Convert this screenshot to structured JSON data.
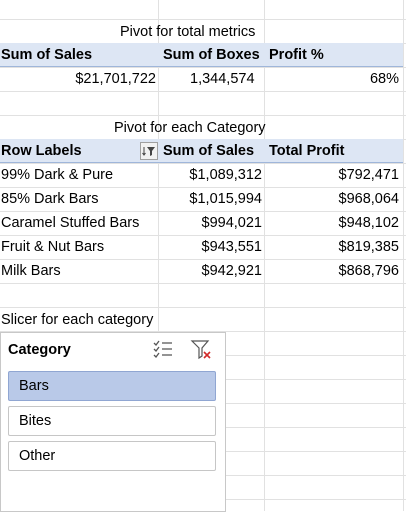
{
  "total_pivot": {
    "title": "Pivot for total metrics",
    "headers": [
      "Sum of Sales",
      "Sum of Boxes",
      "Profit %"
    ],
    "values": [
      "$21,701,722",
      "1,344,574",
      "68%"
    ]
  },
  "category_pivot": {
    "title": "Pivot for each Category",
    "headers": [
      "Row Labels",
      "Sum of Sales",
      "Total Profit"
    ],
    "rows": [
      {
        "label": "99% Dark & Pure",
        "sales": "$1,089,312",
        "profit": "$792,471"
      },
      {
        "label": "85% Dark Bars",
        "sales": "$1,015,994",
        "profit": "$968,064"
      },
      {
        "label": "Caramel Stuffed Bars",
        "sales": "$994,021",
        "profit": "$948,102"
      },
      {
        "label": "Fruit & Nut Bars",
        "sales": "$943,551",
        "profit": "$819,385"
      },
      {
        "label": "Milk Bars",
        "sales": "$942,921",
        "profit": "$868,796"
      }
    ]
  },
  "slicer": {
    "caption": "Slicer for each category",
    "header": "Category",
    "items": [
      {
        "label": "Bars",
        "selected": true
      },
      {
        "label": "Bites",
        "selected": false
      },
      {
        "label": "Other",
        "selected": false
      }
    ]
  },
  "colors": {
    "header_band": "#dde6f4",
    "slicer_selected": "#b9c9e8",
    "gridline": "#e1e1e1"
  },
  "icons": [
    "filter-dropdown-icon",
    "multi-select-icon",
    "clear-filter-icon"
  ]
}
